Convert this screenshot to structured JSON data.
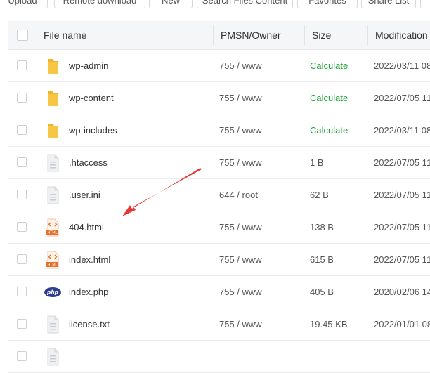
{
  "toolbar": {
    "buttons": [
      "Upload",
      "Remote download",
      "New",
      "Search Files Content",
      "Favorites",
      "Share List",
      ""
    ]
  },
  "table": {
    "headers": {
      "name": "File name",
      "perm": "PMSN/Owner",
      "size": "Size",
      "modified": "Modification"
    },
    "rows": [
      {
        "icon": "folder-icon",
        "name": "wp-admin",
        "perm": "755 / www",
        "size": "Calculate",
        "modified": "2022/03/11 08"
      },
      {
        "icon": "folder-icon",
        "name": "wp-content",
        "perm": "755 / www",
        "size": "Calculate",
        "modified": "2022/07/05 11"
      },
      {
        "icon": "folder-icon",
        "name": "wp-includes",
        "perm": "755 / www",
        "size": "Calculate",
        "modified": "2022/03/11 08"
      },
      {
        "icon": "file-icon",
        "name": ".htaccess",
        "perm": "755 / www",
        "size": "1 B",
        "modified": "2022/07/05 11"
      },
      {
        "icon": "file-icon",
        "name": ".user.ini",
        "perm": "644 / root",
        "size": "62 B",
        "modified": "2022/07/05 11"
      },
      {
        "icon": "html-file-icon",
        "name": "404.html",
        "perm": "755 / www",
        "size": "138 B",
        "modified": "2022/07/05 11"
      },
      {
        "icon": "html-file-icon",
        "name": "index.html",
        "perm": "755 / www",
        "size": "615 B",
        "modified": "2022/07/05 11"
      },
      {
        "icon": "php-file-icon",
        "name": "index.php",
        "perm": "755 / www",
        "size": "405 B",
        "modified": "2020/02/06 14"
      },
      {
        "icon": "file-icon",
        "name": "license.txt",
        "perm": "755 / www",
        "size": "19.45 KB",
        "modified": "2022/01/01 08"
      },
      {
        "icon": "file-icon",
        "name": "",
        "perm": "",
        "size": "",
        "modified": ""
      }
    ]
  },
  "colors": {
    "accent_green": "#20a53a",
    "folder": "#f7c644",
    "html_orange": "#e8702a",
    "php_blue": "#2c3e8f",
    "arrow_red": "#e53935"
  }
}
